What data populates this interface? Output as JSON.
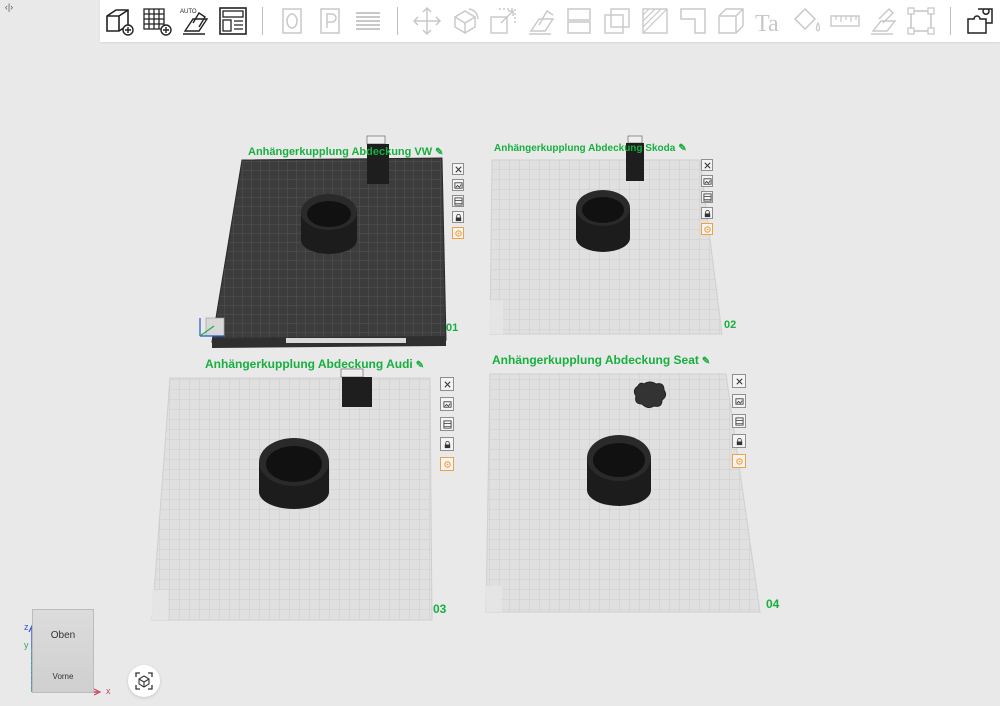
{
  "app": {
    "collapse_tab_glyph": "‹|›"
  },
  "toolbar": {
    "buttons": [
      {
        "icon": "add-model-icon",
        "enabled": true
      },
      {
        "icon": "add-plate-icon",
        "enabled": true
      },
      {
        "icon": "auto-arrange-icon",
        "enabled": true,
        "label": "AUTO"
      },
      {
        "icon": "plate-layout-icon",
        "enabled": true
      },
      {
        "icon": "orient-zero-icon",
        "enabled": false
      },
      {
        "icon": "parking-icon",
        "enabled": false
      },
      {
        "icon": "layers-icon",
        "enabled": false
      },
      {
        "icon": "move-icon",
        "enabled": false
      },
      {
        "icon": "rotate-icon",
        "enabled": false
      },
      {
        "icon": "scale-icon",
        "enabled": false
      },
      {
        "icon": "lay-flat-icon",
        "enabled": false
      },
      {
        "icon": "split-icon",
        "enabled": false
      },
      {
        "icon": "cut-icon",
        "enabled": false
      },
      {
        "icon": "hatch-icon",
        "enabled": false
      },
      {
        "icon": "boolean-icon",
        "enabled": false
      },
      {
        "icon": "hollow-box-icon",
        "enabled": false
      },
      {
        "icon": "text-icon",
        "enabled": false,
        "label": "Ta"
      },
      {
        "icon": "paint-bucket-icon",
        "enabled": false
      },
      {
        "icon": "measure-icon",
        "enabled": false
      },
      {
        "icon": "support-paint-icon",
        "enabled": false
      },
      {
        "icon": "frame-select-icon",
        "enabled": false
      },
      {
        "icon": "assembly-icon",
        "enabled": true
      }
    ]
  },
  "plates": [
    {
      "id": "plate-01",
      "title": "Anhängerkupplung Abdeckung VW",
      "number": "01",
      "selected": true
    },
    {
      "id": "plate-02",
      "title": "Anhängerkupplung Abdeckung Skoda",
      "number": "02",
      "selected": false
    },
    {
      "id": "plate-03",
      "title": "Anhängerkupplung Abdeckung Audi",
      "number": "03",
      "selected": false
    },
    {
      "id": "plate-04",
      "title": "Anhängerkupplung Abdeckung Seat",
      "number": "04",
      "selected": false
    }
  ],
  "plate_tools": [
    "close-icon",
    "image-icon",
    "grid-arrange-icon",
    "lock-icon",
    "settings-icon"
  ],
  "viewcube": {
    "top_face": "Oben",
    "front_face": "Vorne",
    "axis_x": "x",
    "axis_y": "y",
    "axis_z": "z"
  },
  "colors": {
    "accent": "#17b03e",
    "plate_light": "#dcdcdc",
    "plate_dark": "#3b3b3b",
    "model": "#1e1e1e"
  }
}
